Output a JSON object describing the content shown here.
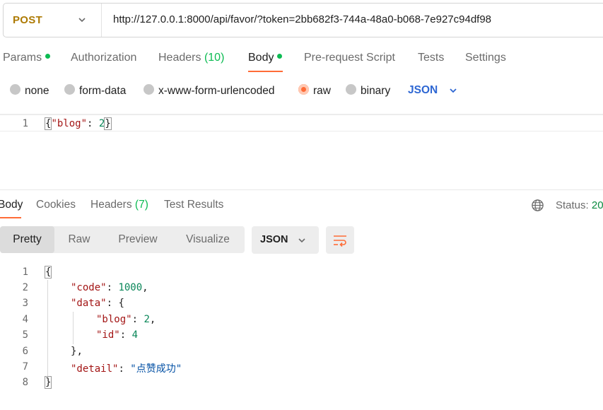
{
  "request": {
    "method": "POST",
    "url": "http://127.0.0.1:8000/api/favor/?token=2bb682f3-744a-48a0-b068-7e927c94df98"
  },
  "request_tabs": {
    "params": "Params",
    "authorization": "Authorization",
    "headers": "Headers",
    "headers_count": "(10)",
    "body": "Body",
    "pre_request": "Pre-request Script",
    "tests": "Tests",
    "settings": "Settings",
    "active": "Body"
  },
  "body_types": {
    "none": "none",
    "form_data": "form-data",
    "urlencoded": "x-www-form-urlencoded",
    "raw": "raw",
    "binary": "binary",
    "selected": "raw",
    "format": "JSON"
  },
  "request_body": {
    "line_number": "1",
    "open_brace": "{",
    "key": "\"blog\"",
    "colon": ": ",
    "value": "2",
    "close_brace": "}"
  },
  "response_tabs": {
    "body": "Body",
    "cookies": "Cookies",
    "headers": "Headers",
    "headers_count": "(7)",
    "test_results": "Test Results",
    "active": "Body",
    "status_label": "Status:",
    "status_value": "20"
  },
  "response_view": {
    "pretty": "Pretty",
    "raw": "Raw",
    "preview": "Preview",
    "visualize": "Visualize",
    "active": "Pretty",
    "format": "JSON"
  },
  "response_body": {
    "line_numbers": [
      "1",
      "2",
      "3",
      "4",
      "5",
      "6",
      "7",
      "8"
    ],
    "l1": "{",
    "l2_key": "\"code\"",
    "l2_value": "1000",
    "l3_key": "\"data\"",
    "l3_open": "{",
    "l4_key": "\"blog\"",
    "l4_value": "2",
    "l5_key": "\"id\"",
    "l5_value": "4",
    "l6": "}",
    "l7_key": "\"detail\"",
    "l7_value": "\"点赞成功\"",
    "l8": "}"
  },
  "colors": {
    "accent": "#ff6c37",
    "method_post": "#ad7a03",
    "json_blue": "#2e67d3",
    "key_red": "#a31515",
    "number_green": "#098658",
    "string_blue": "#0451a5",
    "indicator_green": "#0cbb52"
  },
  "icons": {
    "method_dropdown": "chevron-down-icon",
    "format_dropdown": "chevron-down-icon",
    "globe": "globe-icon",
    "wrap": "wrap-lines-icon"
  }
}
